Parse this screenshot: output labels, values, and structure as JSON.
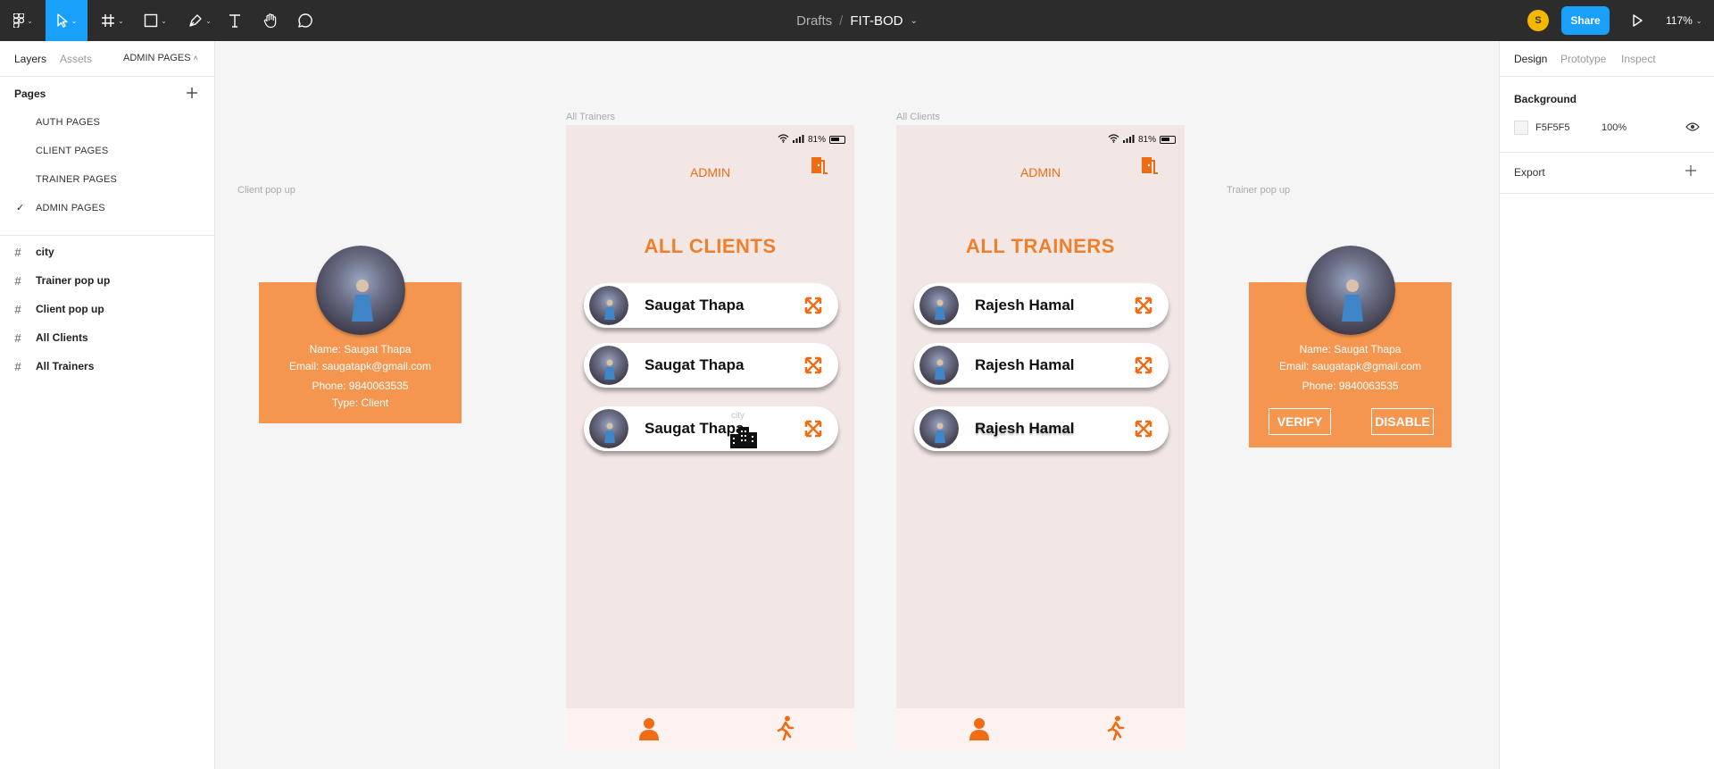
{
  "toolbar": {
    "breadcrumb_drafts": "Drafts",
    "breadcrumb_sep": "/",
    "file_name": "FIT-BOD",
    "avatar_initial": "S",
    "share_label": "Share",
    "zoom_level": "117%",
    "accent": "#18a0fb"
  },
  "left_panel": {
    "tabs": {
      "layers": "Layers",
      "assets": "Assets",
      "current_page": "ADMIN PAGES"
    },
    "pages_header": "Pages",
    "pages": [
      "AUTH PAGES",
      "CLIENT PAGES",
      "TRAINER PAGES",
      "ADMIN PAGES"
    ],
    "layers": [
      "city",
      "Trainer pop up",
      "Client pop up",
      "All Clients",
      "All Trainers"
    ]
  },
  "right_panel": {
    "tabs": {
      "design": "Design",
      "prototype": "Prototype",
      "inspect": "Inspect"
    },
    "background_title": "Background",
    "background_hex": "F5F5F5",
    "background_opacity": "100%",
    "export_title": "Export"
  },
  "canvas": {
    "brand_color": "#ef6c14",
    "frame_labels": {
      "client_popup": "Client pop up",
      "all_trainers": "All Trainers",
      "all_clients": "All Clients",
      "trainer_popup": "Trainer pop up",
      "city": "city"
    },
    "status_battery": "81%",
    "clients_screen": {
      "admin_label": "ADMIN",
      "title": "ALL CLIENTS",
      "items": [
        "Saugat Thapa",
        "Saugat Thapa",
        "Saugat Thapa"
      ]
    },
    "trainers_screen": {
      "admin_label": "ADMIN",
      "title": "ALL TRAINERS",
      "items": [
        "Rajesh Hamal",
        "Rajesh Hamal",
        "Rajesh Hamal"
      ]
    },
    "client_popup": {
      "name": "Name: Saugat Thapa",
      "email": "Email: saugatapk@gmail.com",
      "phone": "Phone: 9840063535",
      "type": "Type: Client"
    },
    "trainer_popup": {
      "name": "Name: Saugat Thapa",
      "email": "Email: saugatapk@gmail.com",
      "phone": "Phone: 9840063535",
      "verify_label": "VERIFY",
      "disable_label": "DISABLE"
    }
  }
}
